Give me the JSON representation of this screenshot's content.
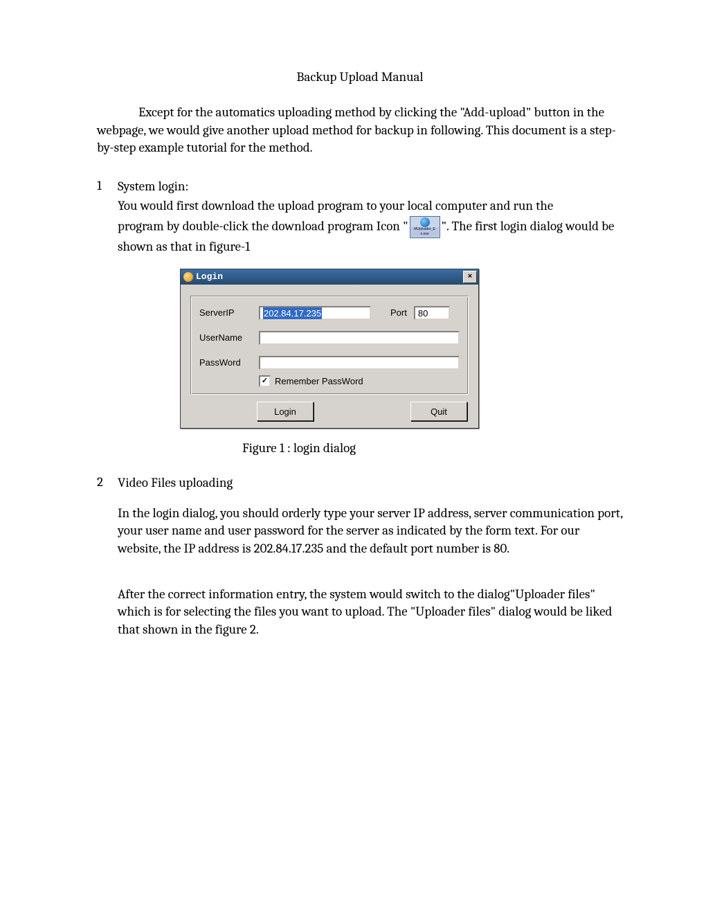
{
  "title": "Backup Upload Manual",
  "intro": "Except for the automatics uploading method by clicking the \"Add-upload\" button in the webpage, we would give another upload method for backup in following. This document is a step-by-step example tutorial for the method.",
  "s1": {
    "num": "1",
    "head": "System login:",
    "p1a": "You would first download the upload program to your local computer and run the",
    "p1b_before": "program by double-click the download program Icon \"",
    "p1b_after": "\". The first login dialog would be shown as that in figure-1",
    "icon_label": "MUploader_E n.exe"
  },
  "dialog": {
    "title": "Login",
    "close": "×",
    "serverip_label": "ServerIP",
    "serverip_value": "202.84.17.235",
    "port_label": "Port",
    "port_value": "80",
    "username_label": "UserName",
    "username_value": "",
    "password_label": "PassWord",
    "password_value": "",
    "remember_label": "Remember PassWord",
    "remember_checked": "✓",
    "login_btn": "Login",
    "quit_btn": "Quit"
  },
  "fig1": "Figure 1 : login dialog",
  "s2": {
    "num": "2",
    "head": "Video Files uploading",
    "p1": "In the login dialog, you should orderly type your server IP address, server communication port, your user name and user password for the server as indicated by the form text. For our website, the IP address is 202.84.17.235 and the default port number is 80.",
    "p2": "After the correct information entry, the system would switch to the dialog\"Uploader files\" which is for selecting the files you want to upload. The \"Uploader files\" dialog would be liked that shown in the figure 2."
  }
}
